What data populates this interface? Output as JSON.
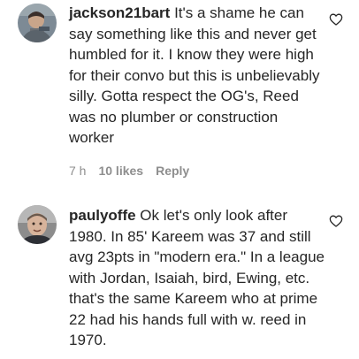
{
  "comments": [
    {
      "username": "jackson21bart",
      "text": "It's a shame he can say something like this and never get humbled for it. I know they were high for their convo but this is unbelievably silly. Gotta respect the OG's, Reed was no plumber or construction worker",
      "time": "7 h",
      "likes": "10 likes",
      "reply": "Reply",
      "avatar_icon": "avatar-photo-icon"
    },
    {
      "username": "paulyoffe",
      "text": "Ok let's only look after 1980. In 85' Kareem was 37 and still avg 23pts in \"modern era.\" In a league with Jordan, Isaiah, bird, Ewing, etc. that's the same Kareem who at prime 22 had his hands full with w. reed in 1970.",
      "avatar_icon": "avatar-photo-icon"
    }
  ],
  "colors": {
    "text": "#262626",
    "secondary": "#8e8e8e",
    "background": "#ffffff"
  },
  "icons": {
    "like": "heart-outline-icon"
  }
}
